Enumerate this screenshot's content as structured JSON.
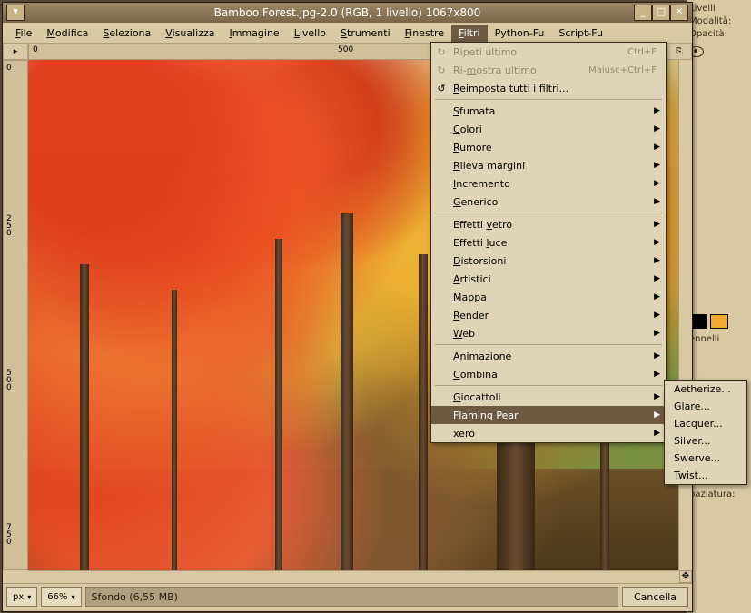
{
  "titlebar": {
    "title": "Bamboo Forest.jpg-2.0 (RGB, 1 livello) 1067x800"
  },
  "menubar": {
    "items": [
      "File",
      "Modifica",
      "Seleziona",
      "Visualizza",
      "Immagine",
      "Livello",
      "Strumenti",
      "Finestre",
      "Filtri",
      "Python-Fu",
      "Script-Fu"
    ],
    "underlines": [
      "F",
      "M",
      "S",
      "V",
      "I",
      "L",
      "S",
      "F",
      "F",
      "",
      ""
    ],
    "active_index": 8
  },
  "ruler": {
    "marks_h": [
      "0",
      "500"
    ],
    "marks_v": [
      "0",
      "250",
      "500",
      "750"
    ]
  },
  "status": {
    "px": "px",
    "zoom": "66%",
    "layer": "Sfondo (6,55 MB)",
    "cancel": "Cancella"
  },
  "filters_menu": {
    "rows": [
      {
        "type": "item",
        "label": "Ripeti ultimo",
        "u": "",
        "icon": "↻",
        "shortcut": "Ctrl+F",
        "disabled": true
      },
      {
        "type": "item",
        "label": "Ri-mostra ultimo",
        "u": "m",
        "icon": "↻",
        "shortcut": "Maiusc+Ctrl+F",
        "disabled": true
      },
      {
        "type": "item",
        "label": "Reimposta tutti i filtri...",
        "u": "R",
        "icon": "↺"
      },
      {
        "type": "sep"
      },
      {
        "type": "sub",
        "label": "Sfumata",
        "u": "S"
      },
      {
        "type": "sub",
        "label": "Colori",
        "u": "C"
      },
      {
        "type": "sub",
        "label": "Rumore",
        "u": "R"
      },
      {
        "type": "sub",
        "label": "Rileva margini",
        "u": "R"
      },
      {
        "type": "sub",
        "label": "Incremento",
        "u": "I"
      },
      {
        "type": "sub",
        "label": "Generico",
        "u": "G"
      },
      {
        "type": "sep"
      },
      {
        "type": "sub",
        "label": "Effetti vetro",
        "u": "v"
      },
      {
        "type": "sub",
        "label": "Effetti luce",
        "u": "l"
      },
      {
        "type": "sub",
        "label": "Distorsioni",
        "u": "D"
      },
      {
        "type": "sub",
        "label": "Artistici",
        "u": "A"
      },
      {
        "type": "sub",
        "label": "Mappa",
        "u": "M"
      },
      {
        "type": "sub",
        "label": "Render",
        "u": "R"
      },
      {
        "type": "sub",
        "label": "Web",
        "u": "W"
      },
      {
        "type": "sep"
      },
      {
        "type": "sub",
        "label": "Animazione",
        "u": "A"
      },
      {
        "type": "sub",
        "label": "Combina",
        "u": "C"
      },
      {
        "type": "sep"
      },
      {
        "type": "sub",
        "label": "Giocattoli",
        "u": "G"
      },
      {
        "type": "sub",
        "label": "Flaming Pear",
        "u": "",
        "highlight": true
      },
      {
        "type": "sub",
        "label": "xero",
        "u": ""
      }
    ]
  },
  "submenu": {
    "items": [
      "Aetherize...",
      "Glare...",
      "Lacquer...",
      "Silver...",
      "Swerve...",
      "Twist..."
    ]
  },
  "sidepanel": {
    "livelli": "Livelli",
    "modalita": "Modalità:",
    "opacita": "Opacità:",
    "ennelli": "ennelli",
    "paziatura": "paziatura:",
    "swatches": [
      "#000000",
      "#f0a830"
    ]
  }
}
